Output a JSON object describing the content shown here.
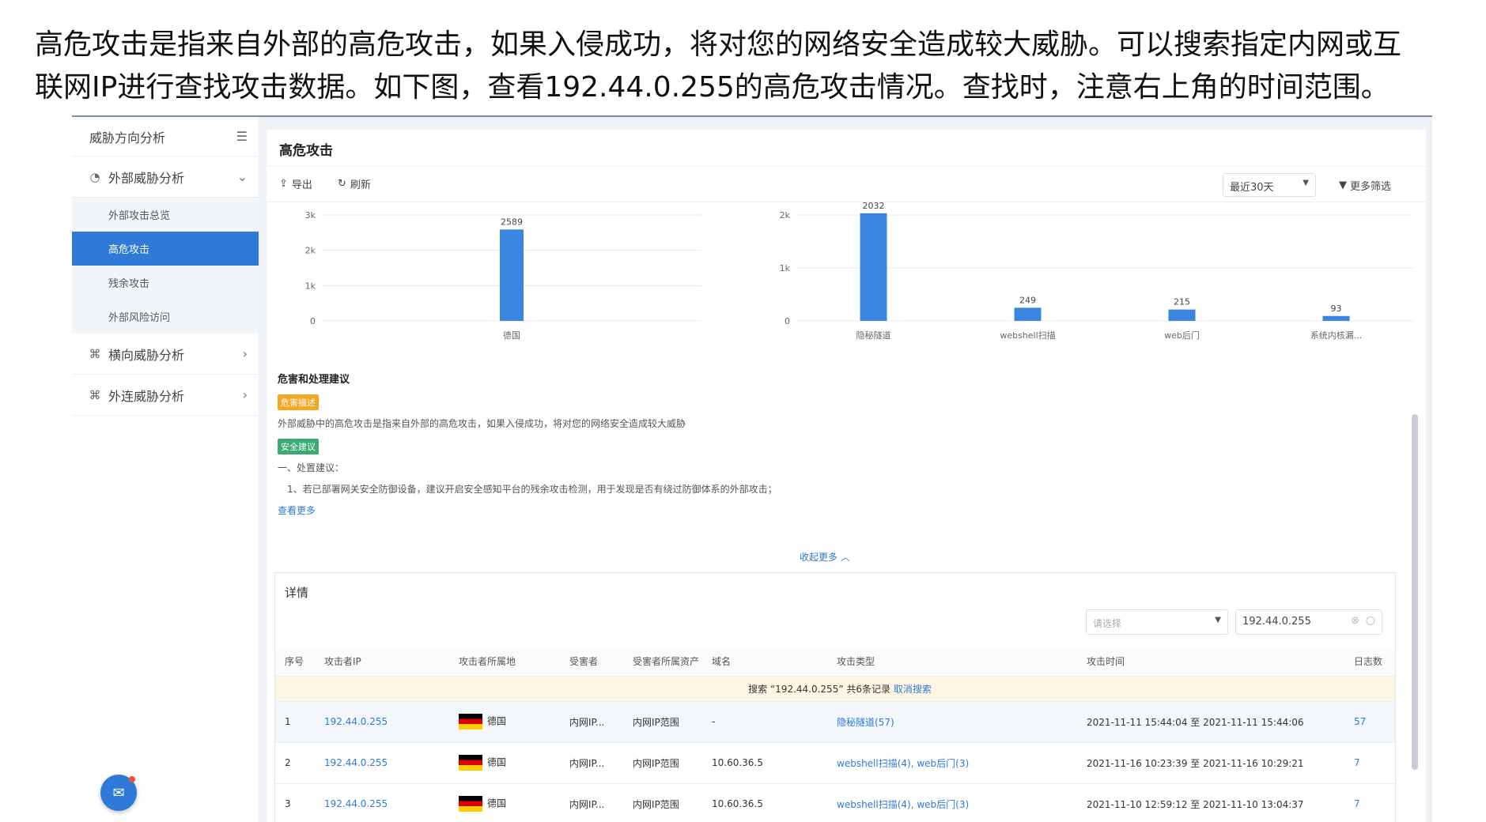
{
  "caption": {
    "line1": "高危攻击是指来自外部的高危攻击，如果入侵成功，将对您的网络安全造成较大威胁。可以搜索指定内网或互",
    "line2": "联网IP进行查找攻击数据。如下图，查看192.44.0.255的高危攻击情况。查找时，注意右上角的时间范围。"
  },
  "sidebar": {
    "title": "威胁方向分析",
    "groups": [
      {
        "label": "外部威胁分析",
        "icon": "clock-icon",
        "expanded": true,
        "items": [
          "外部攻击总览",
          "高危攻击",
          "残余攻击",
          "外部风险访问"
        ],
        "active_index": 1
      },
      {
        "label": "横向威胁分析",
        "icon": "network-icon",
        "expanded": false
      },
      {
        "label": "外连威胁分析",
        "icon": "network-icon",
        "expanded": false
      }
    ]
  },
  "panel": {
    "title": "高危攻击",
    "export_label": "导出",
    "refresh_label": "刷新",
    "time_range": "最近30天",
    "more_filter": "更多筛选"
  },
  "chart_data": [
    {
      "type": "bar",
      "categories": [
        "德国"
      ],
      "values": [
        2589
      ],
      "yticks": [
        "0",
        "1k",
        "2k",
        "3k"
      ],
      "ylim": [
        0,
        3000
      ],
      "data_labels": [
        "2589"
      ]
    },
    {
      "type": "bar",
      "categories": [
        "隐秘隧道",
        "webshell扫描",
        "web后门",
        "系统内核漏..."
      ],
      "values": [
        2032,
        249,
        215,
        93
      ],
      "yticks": [
        "0",
        "1k",
        "2k"
      ],
      "ylim": [
        0,
        2000
      ],
      "data_labels": [
        "2032",
        "249",
        "215",
        "93"
      ]
    }
  ],
  "advice": {
    "title": "危害和处理建议",
    "harm_tag": "危害描述",
    "harm_text": "外部威胁中的高危攻击是指来自外部的高危攻击，如果入侵成功，将对您的网络安全造成较大威胁",
    "safety_tag": "安全建议",
    "line1": "一、处置建议：",
    "line2": "1、若已部署网关安全防御设备，建议开启安全感知平台的残余攻击检测，用于发现是否有绕过防御体系的外部攻击；",
    "see_more": "查看更多",
    "collapse": "收起更多 ︿"
  },
  "details": {
    "title": "详情",
    "select_placeholder": "请选择",
    "search_value": "192.44.0.255",
    "columns": [
      "序号",
      "攻击者IP",
      "攻击者所属地",
      "受害者",
      "受害者所属资产",
      "域名",
      "攻击类型",
      "攻击时间",
      "日志数"
    ],
    "notice_prefix": "搜索 “192.44.0.255” 共6条记录",
    "notice_cancel": "取消搜索",
    "rows": [
      {
        "idx": "1",
        "ip": "192.44.0.255",
        "geo": "德国",
        "victim": "内网IP...",
        "asset": "内网IP范围",
        "domain": "-",
        "type": "隐秘隧道(57)",
        "time": "2021-11-11 15:44:04 至 2021-11-11 15:44:06",
        "logs": "57"
      },
      {
        "idx": "2",
        "ip": "192.44.0.255",
        "geo": "德国",
        "victim": "内网IP...",
        "asset": "内网IP范围",
        "domain": "10.60.36.5",
        "type": "webshell扫描(4), web后门(3)",
        "time": "2021-11-16 10:23:39 至 2021-11-16 10:29:21",
        "logs": "7"
      },
      {
        "idx": "3",
        "ip": "192.44.0.255",
        "geo": "德国",
        "victim": "内网IP...",
        "asset": "内网IP范围",
        "domain": "10.60.36.5",
        "type": "webshell扫描(4), web后门(3)",
        "time": "2021-11-10 12:59:12 至 2021-11-10 13:04:37",
        "logs": "7"
      }
    ]
  },
  "colors": {
    "accent": "#2f7ad8",
    "bar": "#3a86de",
    "warning": "#f5a623",
    "success": "#3bab73"
  }
}
